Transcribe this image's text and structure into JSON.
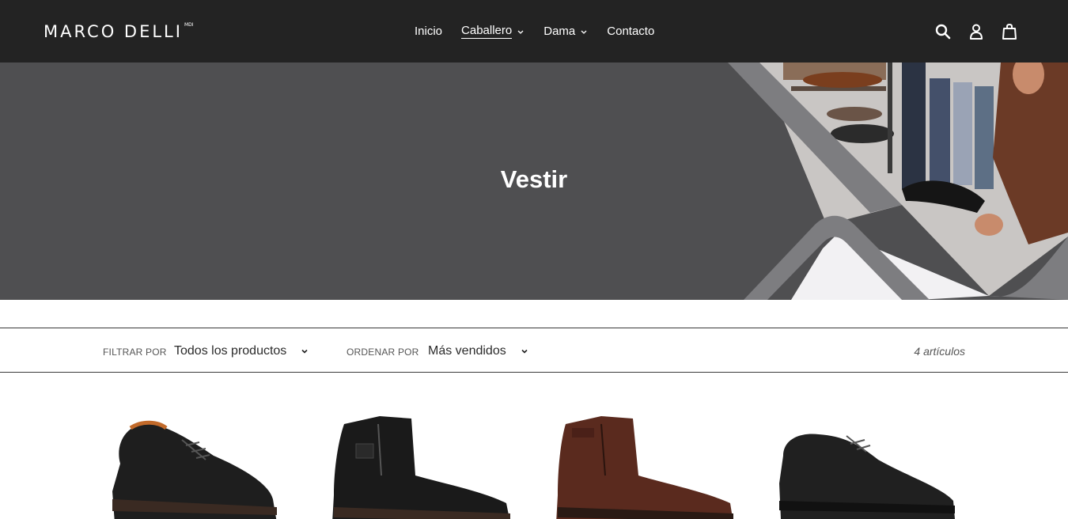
{
  "brand": {
    "name": "MARCO DELLI",
    "mark": "MDI"
  },
  "nav": {
    "items": [
      {
        "label": "Inicio",
        "dropdown": false
      },
      {
        "label": "Caballero",
        "dropdown": true,
        "active": true
      },
      {
        "label": "Dama",
        "dropdown": true
      },
      {
        "label": "Contacto",
        "dropdown": false
      }
    ]
  },
  "header_icons": [
    "search-icon",
    "account-icon",
    "cart-icon"
  ],
  "hero": {
    "title": "Vestir"
  },
  "filters": {
    "filter_label": "FILTRAR POR",
    "filter_value": "Todos los productos",
    "sort_label": "ORDENAR POR",
    "sort_value": "Más vendidos",
    "count": "4 artículos"
  },
  "products": [
    {
      "name": "oxford-black-shoe",
      "color": "#1e1e1e"
    },
    {
      "name": "black-zip-boot",
      "color": "#1a1a1a"
    },
    {
      "name": "brown-zip-boot",
      "color": "#5a2a1e"
    },
    {
      "name": "black-derby-shoe",
      "color": "#202020"
    }
  ],
  "colors": {
    "header_bg": "#232323",
    "hero_bg": "#4f4f51",
    "text_white": "#ffffff"
  }
}
